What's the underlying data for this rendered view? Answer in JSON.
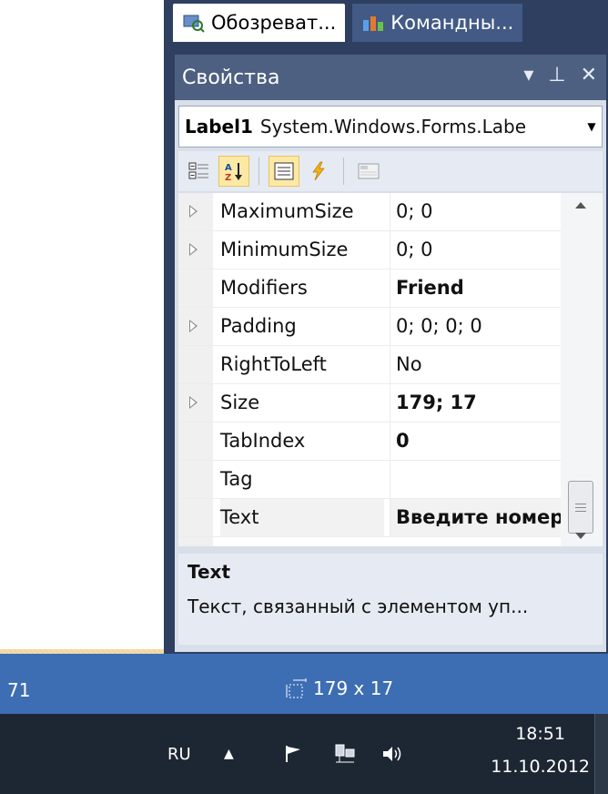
{
  "tabs": [
    {
      "label": "Обозреват...",
      "active": true
    },
    {
      "label": "Командны...",
      "active": false
    }
  ],
  "properties": {
    "title": "Свойства",
    "object_name": "Label1",
    "object_type": "System.Windows.Forms.Labe",
    "rows": [
      {
        "name": "MaximumSize",
        "value": "0; 0",
        "expandable": true,
        "bold": false
      },
      {
        "name": "MinimumSize",
        "value": "0; 0",
        "expandable": true,
        "bold": false
      },
      {
        "name": "Modifiers",
        "value": "Friend",
        "expandable": false,
        "bold": true
      },
      {
        "name": "Padding",
        "value": "0; 0; 0; 0",
        "expandable": true,
        "bold": false
      },
      {
        "name": "RightToLeft",
        "value": "No",
        "expandable": false,
        "bold": false
      },
      {
        "name": "Size",
        "value": "179; 17",
        "expandable": true,
        "bold": true
      },
      {
        "name": "TabIndex",
        "value": "0",
        "expandable": false,
        "bold": true
      },
      {
        "name": "Tag",
        "value": "",
        "expandable": false,
        "bold": false
      },
      {
        "name": "Text",
        "value": "Введите номер",
        "expandable": false,
        "bold": true,
        "selected": true
      }
    ],
    "description_title": "Text",
    "description_text": "Текст, связанный с элементом уп..."
  },
  "status": {
    "coord": "71",
    "size": "179 x 17"
  },
  "taskbar": {
    "language": "RU",
    "time": "18:51",
    "date": "11.10.2012"
  },
  "colors": {
    "vs_background": "#2e3f60",
    "title_bar": "#4d6082",
    "status_bar": "#3d6eb4",
    "taskbar": "#1c2733",
    "slide_background": "#f3d9a6"
  }
}
